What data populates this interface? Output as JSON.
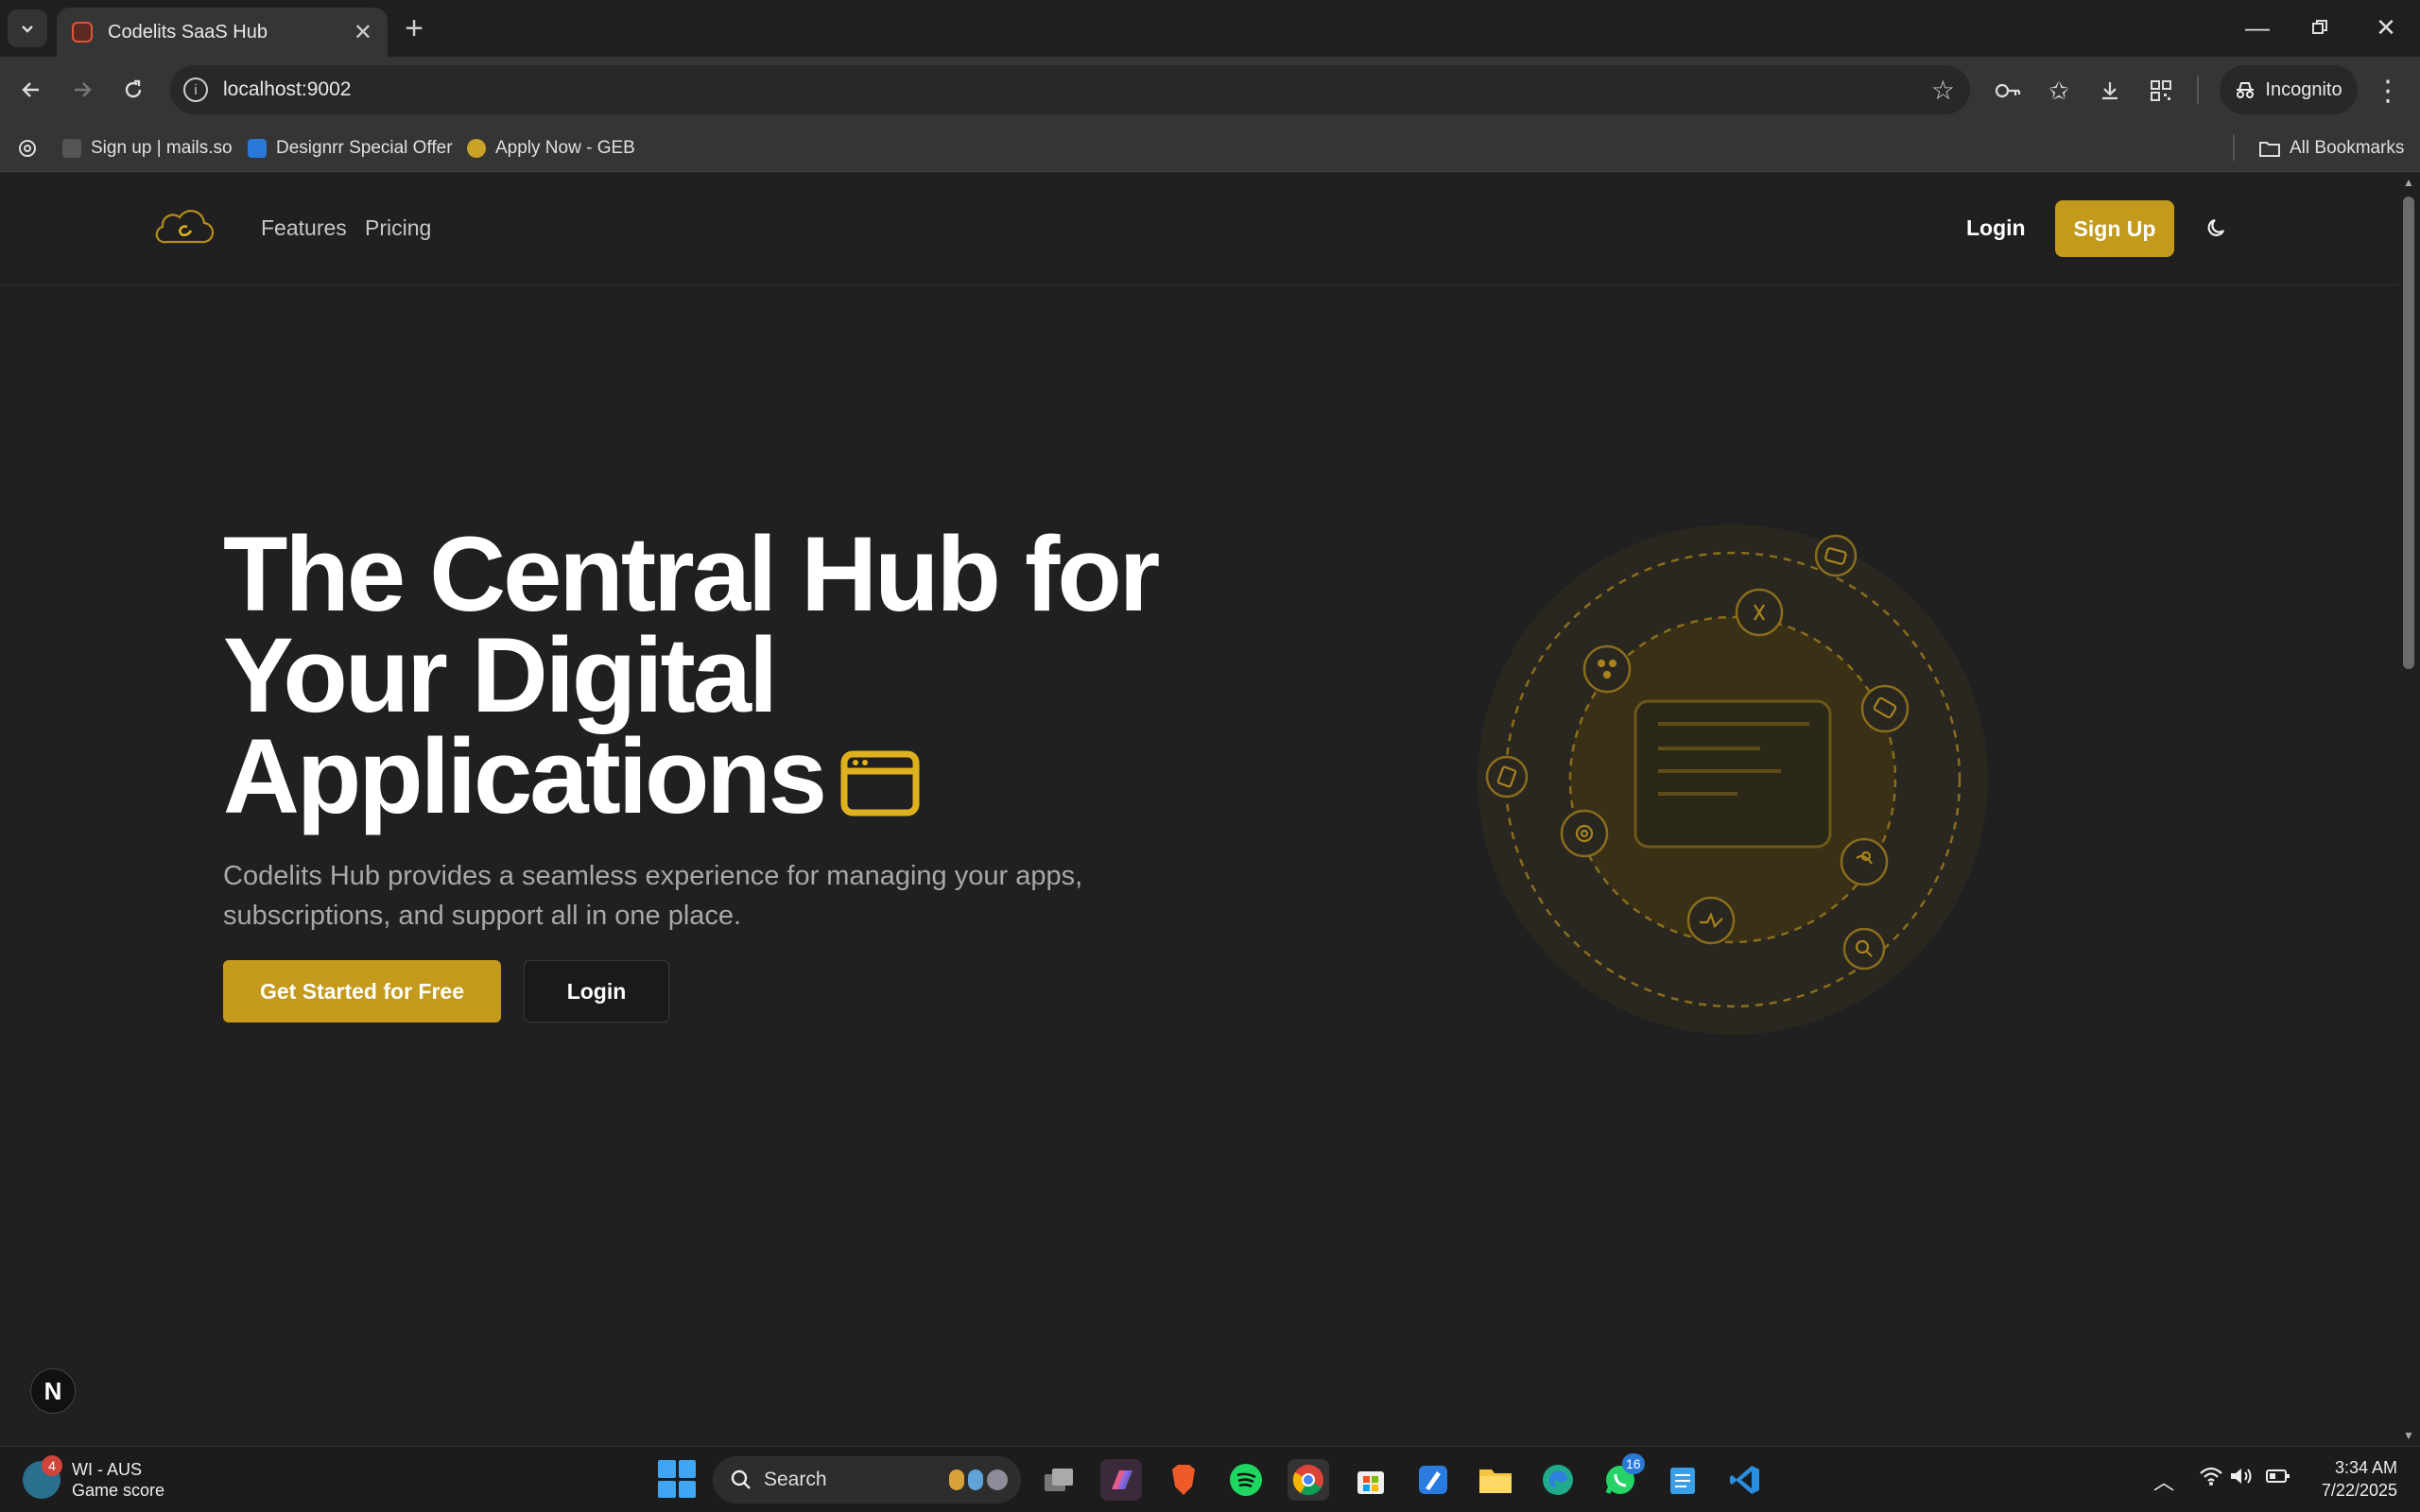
{
  "browser": {
    "tab_title": "Codelits SaaS Hub",
    "url": "localhost:9002",
    "incognito_label": "Incognito",
    "bookmarks": [
      "Sign up | mails.so",
      "Designrr Special Offer",
      "Apply Now - GEB"
    ],
    "all_bookmarks_label": "All Bookmarks"
  },
  "site_nav": {
    "links": [
      "Features",
      "Pricing"
    ],
    "login_label": "Login",
    "signup_label": "Sign Up"
  },
  "hero": {
    "title_lines": [
      "The Central Hub for",
      "Your Digital",
      "Applications"
    ],
    "subtitle": "Codelits Hub provides a seamless experience for managing your apps, subscriptions, and support all in one place.",
    "cta_primary": "Get Started for Free",
    "cta_secondary": "Login"
  },
  "nextjs_badge": "N",
  "taskbar": {
    "weather_title": "WI - AUS",
    "weather_sub": "Game score",
    "weather_badge": "4",
    "search_label": "Search",
    "whatsapp_badge": "16",
    "time": "3:34 AM",
    "date": "7/22/2025"
  },
  "colors": {
    "accent": "#c39a1b",
    "background": "#202020",
    "icon_gold": "#e0b11e"
  }
}
